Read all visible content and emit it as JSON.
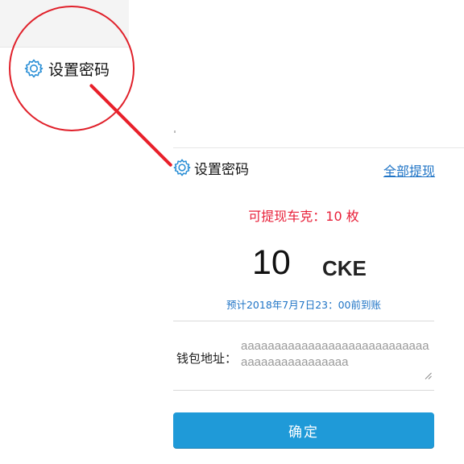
{
  "zoom_callout": {
    "settings_label": "设置密码",
    "accent_color": "#e0202a"
  },
  "panel": {
    "settings_label": "设置密码",
    "withdraw_all_link": "全部提现",
    "available": "可提现车克：10 枚",
    "amount": "10",
    "unit": "CKE",
    "eta": "预计2018年7月7日23：00前到账",
    "wallet": {
      "label": "钱包地址：",
      "value": "aaaaaaaaaaaaaaaaaaaaaaaaaaaaaaaaaaaaaaaaaaaa"
    },
    "confirm_button": "确定"
  },
  "icons": {
    "settings": "gear-icon",
    "resize": "resize-grip-icon"
  },
  "colors": {
    "primary": "#1f9ad8",
    "link": "#1f74c6",
    "alert": "#e8213a"
  }
}
